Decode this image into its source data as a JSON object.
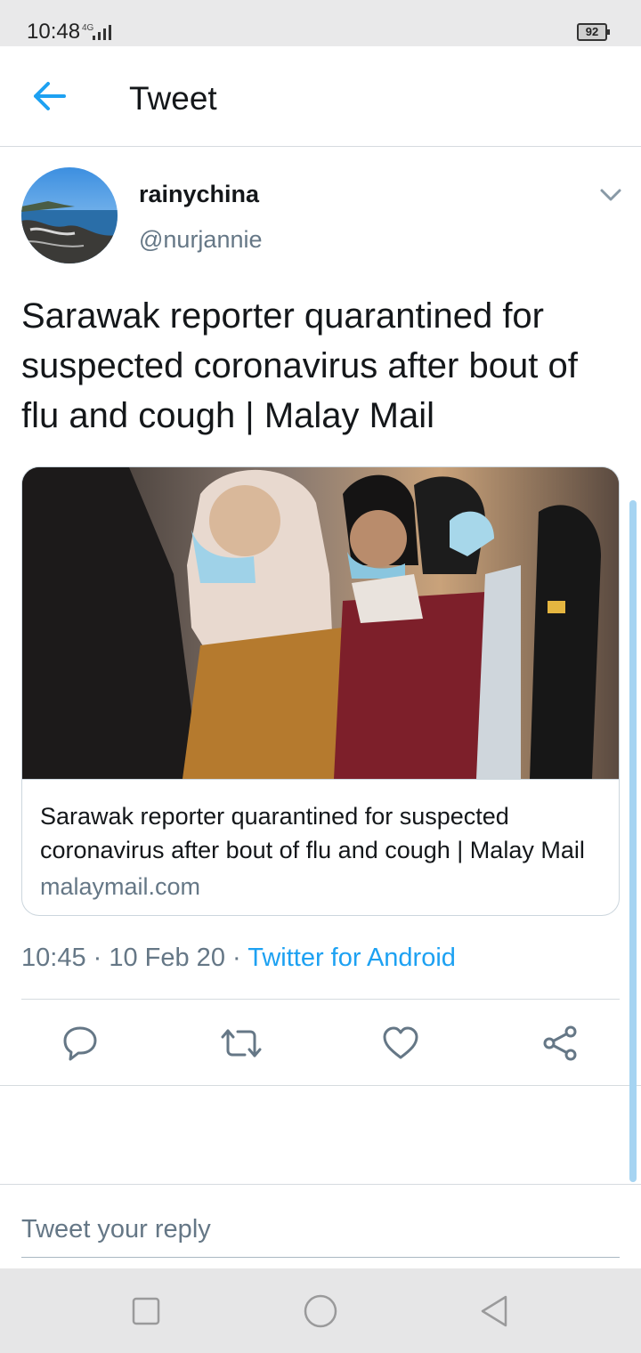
{
  "status_bar": {
    "time": "10:48",
    "network": "4G",
    "battery": "92"
  },
  "header": {
    "title": "Tweet",
    "back_icon": "back-arrow-icon"
  },
  "tweet": {
    "user": {
      "name": "rainychina",
      "handle": "@nurjannie"
    },
    "text": "Sarawak reporter quarantined for suspected coronavirus after bout of flu and cough | Malay Mail",
    "card": {
      "title": "Sarawak reporter quarantined for suspected coronavirus after bout of flu and cough | Malay Mail",
      "domain": "malaymail.com"
    },
    "meta": {
      "timestamp": "10:45 · 10 Feb 20 · ",
      "source": "Twitter for Android"
    },
    "actions": [
      "reply-icon",
      "retweet-icon",
      "like-icon",
      "share-icon"
    ]
  },
  "reply": {
    "placeholder": "Tweet your reply"
  },
  "colors": {
    "accent": "#1da1f2",
    "secondary_text": "#657786",
    "divider": "#d6dbdf"
  }
}
